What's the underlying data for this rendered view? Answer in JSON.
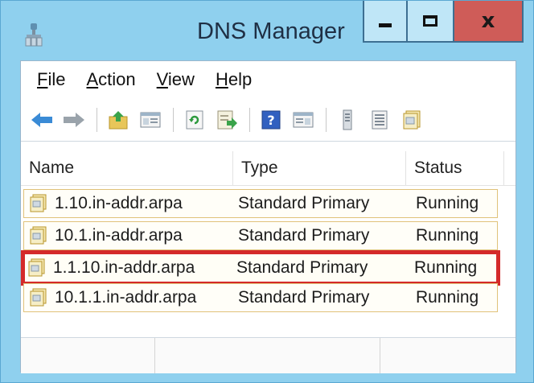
{
  "window": {
    "title": "DNS Manager",
    "close_label": "x",
    "app_icon": "dns-manager-icon"
  },
  "menu": {
    "items": [
      {
        "mnemonic": "F",
        "rest": "ile"
      },
      {
        "mnemonic": "A",
        "rest": "ction"
      },
      {
        "mnemonic": "V",
        "rest": "iew"
      },
      {
        "mnemonic": "H",
        "rest": "elp"
      }
    ]
  },
  "toolbar": {
    "icons": [
      "back-arrow-icon",
      "forward-arrow-icon",
      "up-folder-icon",
      "show-hide-console-tree-icon",
      "refresh-icon",
      "export-list-icon",
      "help-icon",
      "show-hide-action-pane-icon",
      "server-icon",
      "list-view-icon",
      "zone-properties-icon"
    ]
  },
  "list": {
    "columns": {
      "name": "Name",
      "type": "Type",
      "status": "Status"
    },
    "rows": [
      {
        "name": "1.10.in-addr.arpa",
        "type": "Standard Primary",
        "status": "Running"
      },
      {
        "name": "10.1.in-addr.arpa",
        "type": "Standard Primary",
        "status": "Running"
      },
      {
        "name": "1.1.10.in-addr.arpa",
        "type": "Standard Primary",
        "status": "Running"
      },
      {
        "name": "10.1.1.in-addr.arpa",
        "type": "Standard Primary",
        "status": "Running"
      }
    ],
    "highlighted_row_color": "#d42a2a"
  }
}
